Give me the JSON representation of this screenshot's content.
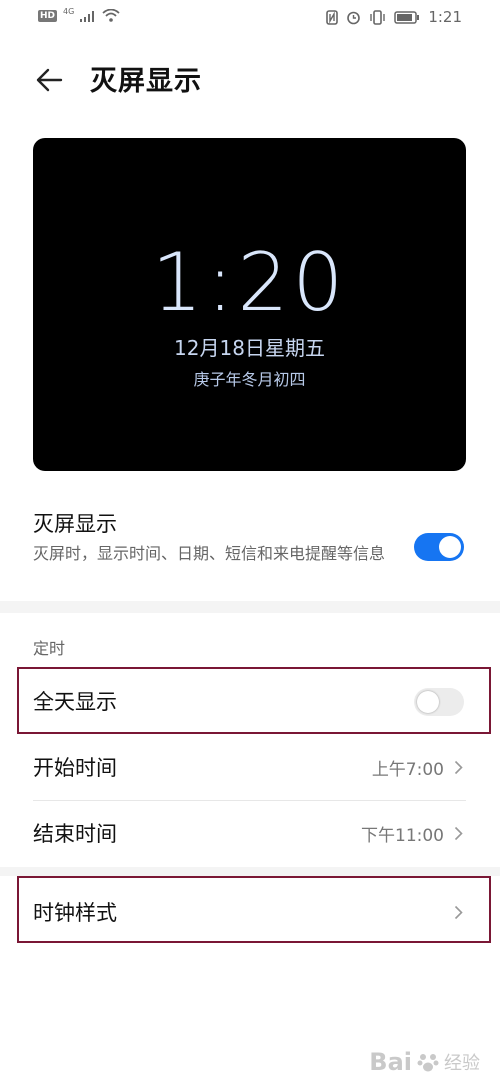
{
  "status": {
    "hd": "HD",
    "network": "4G",
    "time": "1:21"
  },
  "header": {
    "title": "灭屏显示"
  },
  "preview": {
    "clock": "1:20",
    "date": "12月18日星期五",
    "lunar_date": "庚子年冬月初四"
  },
  "aod_setting": {
    "title": "灭屏显示",
    "description": "灭屏时，显示时间、日期、短信和来电提醒等信息",
    "enabled": true
  },
  "timer": {
    "section_label": "定时",
    "all_day": {
      "label": "全天显示",
      "enabled": false
    },
    "start": {
      "label": "开始时间",
      "value": "上午7:00"
    },
    "end": {
      "label": "结束时间",
      "value": "下午11:00"
    }
  },
  "clock_style": {
    "label": "时钟样式"
  },
  "watermark": {
    "brand": "Bai",
    "suffix": "经验"
  },
  "colors": {
    "accent": "#1675f2",
    "highlight_border": "#7a1735"
  }
}
